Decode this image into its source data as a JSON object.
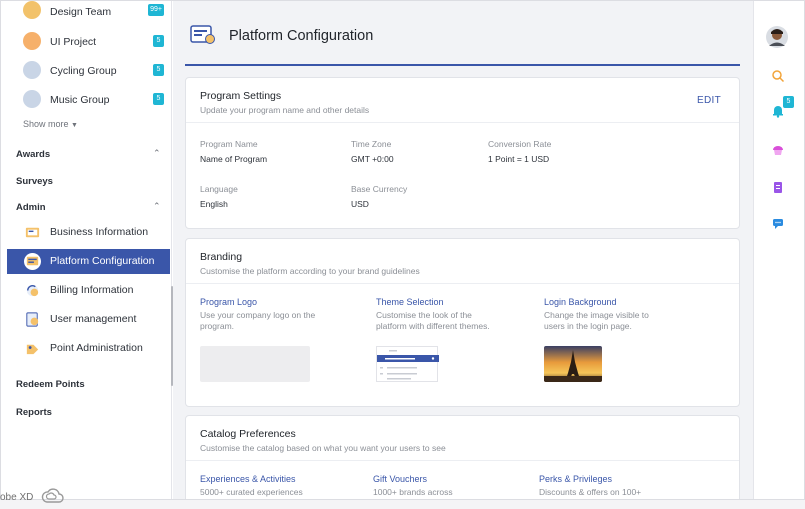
{
  "sidebar": {
    "groups": [
      {
        "label": "Design Team",
        "badge": "99+"
      },
      {
        "label": "UI Project",
        "badge": "5"
      },
      {
        "label": "Cycling Group",
        "badge": "5"
      },
      {
        "label": "Music Group",
        "badge": "5"
      }
    ],
    "show_more": "Show more",
    "sections": {
      "awards": "Awards",
      "surveys": "Surveys",
      "admin": "Admin",
      "redeem": "Redeem Points",
      "reports": "Reports"
    },
    "admin_items": [
      {
        "label": "Business Information"
      },
      {
        "label": "Platform Configuration"
      },
      {
        "label": "Billing Information"
      },
      {
        "label": "User management"
      },
      {
        "label": "Point Administration"
      }
    ]
  },
  "main": {
    "page_title": "Platform Configuration",
    "program_settings": {
      "title": "Program Settings",
      "subtitle": "Update your program name and other details",
      "edit_label": "EDIT",
      "fields": {
        "program_name_label": "Program Name",
        "program_name_value": "Name of Program",
        "time_zone_label": "Time Zone",
        "time_zone_value": "GMT +0:00",
        "conversion_label": "Conversion Rate",
        "conversion_value": "1 Point = 1 USD",
        "language_label": "Language",
        "language_value": "English",
        "currency_label": "Base Currency",
        "currency_value": "USD"
      }
    },
    "branding": {
      "title": "Branding",
      "subtitle": "Customise the platform according to your brand guidelines",
      "items": [
        {
          "title": "Program Logo",
          "desc": "Use your company logo on the program."
        },
        {
          "title": "Theme Selection",
          "desc": "Customise the look of the platform with different themes."
        },
        {
          "title": "Login Background",
          "desc": "Change the image visible to users in the login page."
        }
      ]
    },
    "catalog": {
      "title": "Catalog Preferences",
      "subtitle": "Customise the catalog based on what you want your users to see",
      "items": [
        {
          "title": "Experiences & Activities",
          "desc": "5000+ curated experiences"
        },
        {
          "title": "Gift Vouchers",
          "desc": "1000+ brands across"
        },
        {
          "title": "Perks & Privileges",
          "desc": "Discounts & offers on 100+"
        }
      ]
    }
  },
  "rail": {
    "notification_count": "5"
  },
  "footer": {
    "xd_label": "obe XD"
  },
  "colors": {
    "accent": "#3a56a9",
    "badge": "#1fb6d4"
  }
}
